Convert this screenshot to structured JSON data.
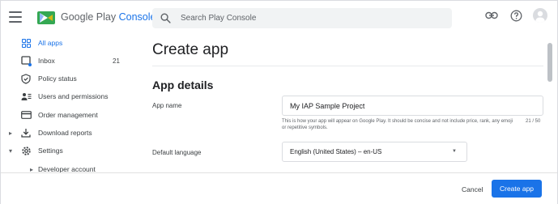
{
  "topbar": {
    "menu_icon": "hamburger-menu-icon",
    "logo": {
      "word_google": "Google Play",
      "word_console": "Console"
    },
    "search": {
      "placeholder": "Search Play Console",
      "icon": "search-icon"
    },
    "actions": [
      "link-icon",
      "help-icon",
      "account-avatar"
    ]
  },
  "sidebar": {
    "items": [
      {
        "label": "All apps",
        "icon": "apps-grid-icon",
        "active": true
      },
      {
        "label": "Inbox",
        "icon": "inbox-icon",
        "count": "21"
      },
      {
        "label": "Policy status",
        "icon": "shield-check-icon"
      },
      {
        "label": "Users and permissions",
        "icon": "users-icon"
      },
      {
        "label": "Order management",
        "icon": "credit-card-icon"
      },
      {
        "label": "Download reports",
        "icon": "download-icon",
        "expander": "▸"
      },
      {
        "label": "Settings",
        "icon": "gear-icon",
        "expander": "▾"
      },
      {
        "label": "Developer account",
        "expander": "▸"
      }
    ]
  },
  "main": {
    "title": "Create app",
    "section": "App details",
    "app_name": {
      "label": "App name",
      "value": "My IAP Sample Project",
      "helper": "This is how your app will appear on Google Play. It should be concise and not include price, rank, any emoji or repetitive symbols.",
      "counter": "21 / 50"
    },
    "default_language": {
      "label": "Default language",
      "value": "English (United States) – en-US",
      "caret": "▼"
    }
  },
  "footer": {
    "cancel_label": "Cancel",
    "create_label": "Create app"
  },
  "colors": {
    "accent": "#1a73e8",
    "text": "#202124",
    "muted": "#5f6368"
  }
}
